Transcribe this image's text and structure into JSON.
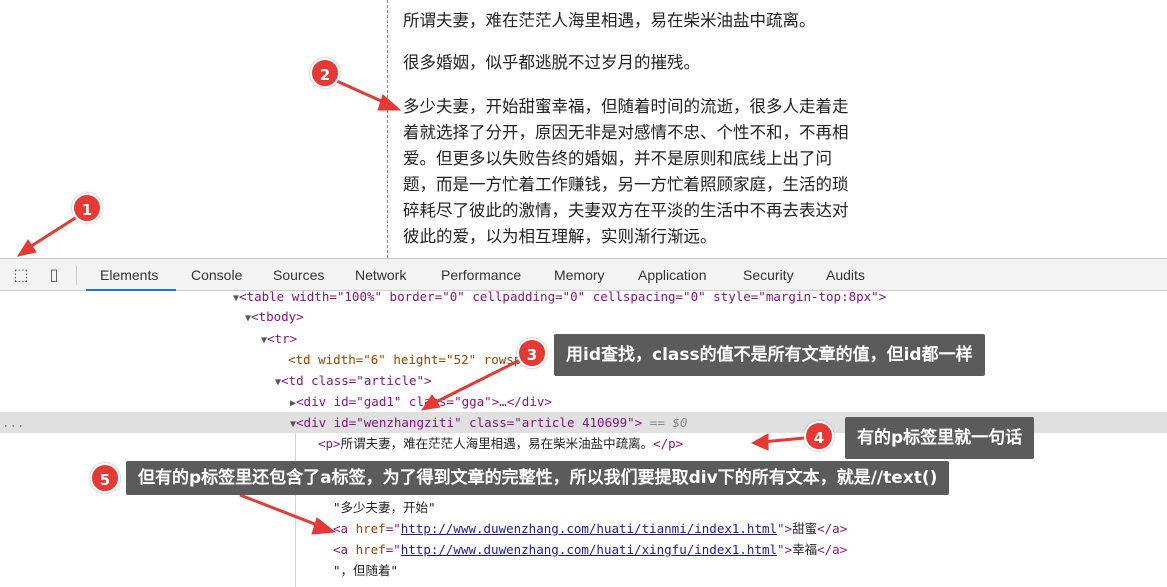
{
  "page": {
    "paragraphs": [
      [
        "所谓夫妻，难在茫茫人海里相遇，易在柴米油盐中疏离。"
      ],
      [
        "很多婚姻，似乎都逃脱不过岁月的摧残。"
      ],
      [
        "多少夫妻，开始甜蜜幸福，但随着时间的流逝，很多人走着走",
        "着就选择了分开，原因无非是对感情不忠、个性不和，不再相",
        "爱。但更多以失败告终的婚姻，并不是原则和底线上出了问",
        "题，而是一方忙着工作赚钱，另一方忙着照顾家庭，生活的琐",
        "碎耗尽了彼此的激情，夫妻双方在平淡的生活中不再去表达对",
        "彼此的爱，以为相互理解，实则渐行渐远。"
      ]
    ]
  },
  "toolbar": {
    "icons": [
      "inspect-element-icon",
      "device-toolbar-icon"
    ],
    "tabs": [
      "Elements",
      "Console",
      "Sources",
      "Network",
      "Performance",
      "Memory",
      "Application",
      "Security",
      "Audits"
    ],
    "active": "Elements"
  },
  "dom": {
    "r0": "<table width=\"100%\" border=\"0\" cellpadding=\"0\" cellspacing=\"0\" style=\"margin-top:8px\">",
    "r1": "<tbody>",
    "r2": "<tr>",
    "r3": "<td width=\"6\" height=\"52\" rowspan=",
    "r4": "<td class=\"article\">",
    "r5": "<div id=\"gad1\" class=\"gga\">…</div>",
    "r6": "<div id=\"wenzhangziti\" class=\"article 410699\">",
    "r6b": " == $0",
    "r7": "所谓夫妻，难在茫茫人海里相遇，易在柴米油盐中疏离。",
    "r8": "…",
    "r10": "\"多少夫妻，开始\"",
    "link1": "http://www.duwenzhang.com/huati/tianmi/index1.html",
    "link1_text": "甜蜜",
    "link2": "http://www.duwenzhang.com/huati/xingfu/index1.html",
    "link2_text": "幸福",
    "r13": "\"，但随着\"",
    "ellipsis": "..."
  },
  "annotations": [
    {
      "n": "1"
    },
    {
      "n": "2"
    },
    {
      "n": "3",
      "text": "用id查找，class的值不是所有文章的值，但id都一样"
    },
    {
      "n": "4",
      "text": "有的p标签里就一句话"
    },
    {
      "n": "5",
      "text": "但有的p标签里还包含了a标签，为了得到文章的完整性，所以我们要提取div下的所有文本，就是//text()"
    }
  ],
  "colors": {
    "annotation_red": "#e53935",
    "note_bg": "#5b5b5b",
    "active_tab": "#1a73e8"
  }
}
